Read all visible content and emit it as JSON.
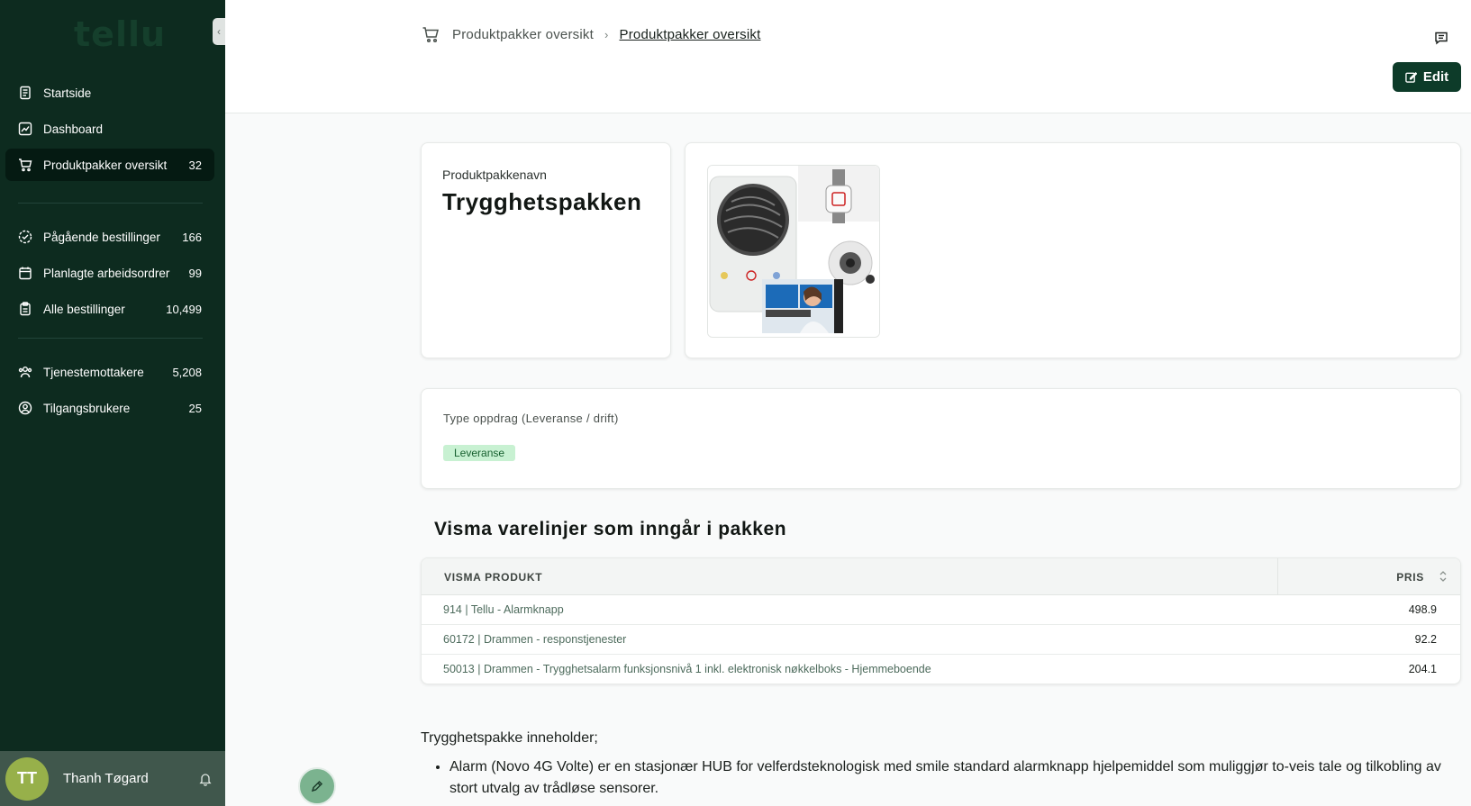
{
  "app": {
    "logo": "tellu"
  },
  "sidebar": {
    "collapse_glyph": "‹",
    "groups": [
      [
        {
          "label": "Startside",
          "icon": "document-icon",
          "count": ""
        },
        {
          "label": "Dashboard",
          "icon": "chart-icon",
          "count": ""
        },
        {
          "label": "Produktpakker oversikt",
          "icon": "cart-icon",
          "count": "32",
          "active": true
        }
      ],
      [
        {
          "label": "Pågående bestillinger",
          "icon": "progress-check-icon",
          "count": "166"
        },
        {
          "label": "Planlagte arbeidsordrer",
          "icon": "calendar-icon",
          "count": "99"
        },
        {
          "label": "Alle bestillinger",
          "icon": "clipboard-icon",
          "count": "10,499"
        }
      ],
      [
        {
          "label": "Tjenestemottakere",
          "icon": "users-icon",
          "count": "5,208"
        },
        {
          "label": "Tilgangsbrukere",
          "icon": "user-circle-icon",
          "count": "25"
        }
      ]
    ],
    "user": {
      "initials": "TT",
      "name": "Thanh Tøgard"
    }
  },
  "header": {
    "breadcrumb": [
      "Produktpakker oversikt",
      "Produktpakker oversikt"
    ],
    "separator": "›",
    "edit_label": "Edit"
  },
  "package": {
    "name_label": "Produktpakkenavn",
    "name": "Trygghetspakken",
    "type_label": "Type oppdrag (Leveranse / drift)",
    "type_value": "Leveranse"
  },
  "lines": {
    "title": "Visma varelinjer som inngår i pakken",
    "columns": [
      "VISMA PRODUKT",
      "PRIS"
    ],
    "rows": [
      {
        "product": "914 | Tellu - Alarmknapp",
        "price": "498.9"
      },
      {
        "product": "60172 | Drammen - responstjenester",
        "price": "92.2"
      },
      {
        "product": "50013 | Drammen - Trygghetsalarm funksjonsnivå 1 inkl. elektronisk nøkkelboks - Hjemmeboende",
        "price": "204.1"
      }
    ]
  },
  "description": {
    "intro": "Trygghetspakke inneholder;",
    "bullets": [
      "Alarm (Novo 4G Volte) er en stasjonær HUB for velferdsteknologisk med smile standard alarmknapp hjelpemiddel som muliggjør to-veis tale og tilkobling av stort utvalg av trådløse sensorer."
    ]
  },
  "colors": {
    "sidebar_bg": "#0d2b1f",
    "accent": "#0d3b29",
    "badge_bg": "#c8f1d2"
  }
}
